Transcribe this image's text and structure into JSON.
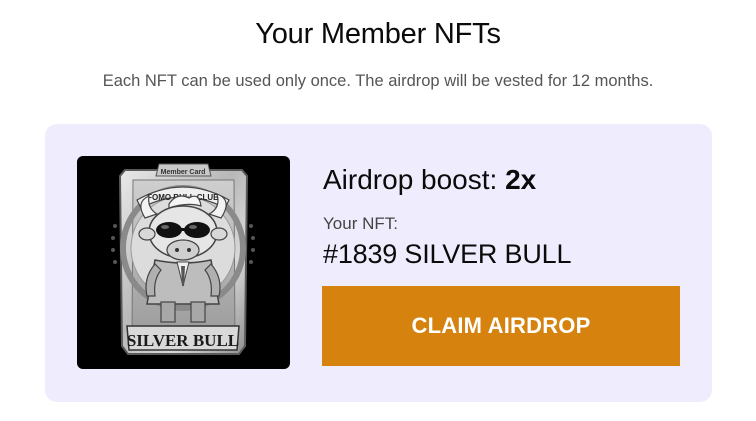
{
  "page": {
    "title": "Your Member NFTs",
    "subtitle": "Each NFT can be used only once. The airdrop will be vested for 12 months."
  },
  "card": {
    "boost_label": "Airdrop boost: ",
    "boost_value": "2x",
    "your_nft_label": "Your NFT:",
    "nft_name": "#1839 SILVER BULL",
    "claim_button_label": "CLAIM AIRDROP",
    "nft_image": {
      "description_icon": "silver-bull-member-card",
      "card_header_text": "Member Card",
      "club_text": "FOMO BULL CLUB",
      "tier_text": "SILVER BULL"
    }
  },
  "colors": {
    "card_background": "#efedfd",
    "button_background": "#d6820e",
    "button_text": "#ffffff"
  }
}
